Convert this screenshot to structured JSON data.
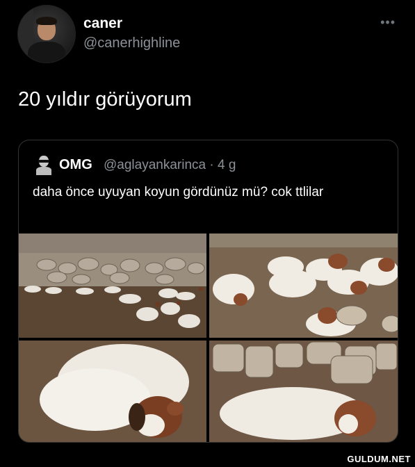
{
  "author": {
    "display_name": "caner",
    "handle": "@canerhighline"
  },
  "menu": {
    "more_icon": "more-dots-icon",
    "more_glyph": "•••"
  },
  "tweet": {
    "text": "20 yıldır görüyorum"
  },
  "quoted_tweet": {
    "display_name": "OMG",
    "handle_time": "@aglayankarinca · 4 g",
    "text": "daha önce uyuyan koyun gördünüz mü? cok ttlilar",
    "photos": [
      "sleeping-sheep-photo-1",
      "sleeping-sheep-photo-2",
      "sleeping-sheep-photo-3",
      "sleeping-sheep-photo-4"
    ]
  },
  "watermark": "GULDUM.NET",
  "colors": {
    "background": "#000000",
    "text": "#ffffff",
    "secondary": "#8b9197",
    "border": "#333333"
  }
}
